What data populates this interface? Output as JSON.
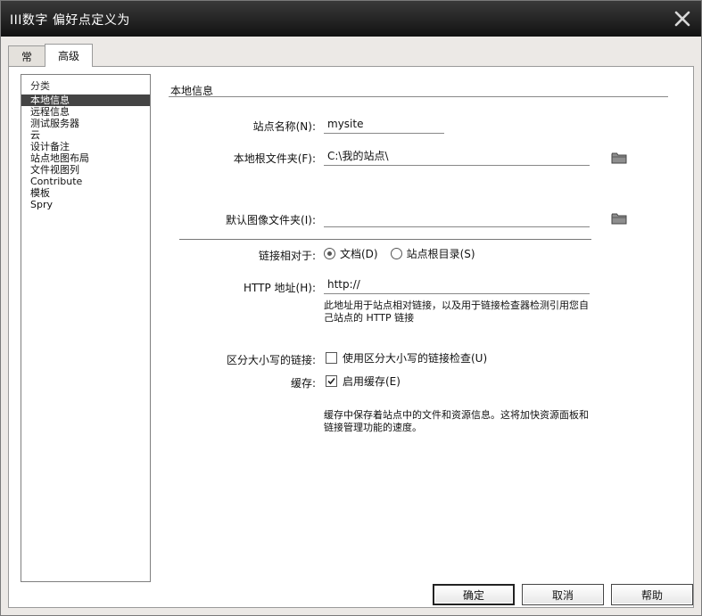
{
  "window": {
    "title": "III数字 偏好点定义为"
  },
  "tabs": [
    {
      "label": "常"
    },
    {
      "label": "高级"
    }
  ],
  "sidebar": {
    "heading": "分类",
    "items": [
      {
        "label": "本地信息"
      },
      {
        "label": "远程信息"
      },
      {
        "label": "测试服务器"
      },
      {
        "label": "云"
      },
      {
        "label": "设计备注"
      },
      {
        "label": "站点地图布局"
      },
      {
        "label": "文件视图列"
      },
      {
        "label": "Contribute"
      },
      {
        "label": "模板"
      },
      {
        "label": "Spry"
      }
    ],
    "selected_index": 0
  },
  "section": {
    "title": "本地信息"
  },
  "form": {
    "site_name_label": "站点名称(N):",
    "site_name_value": "mysite",
    "local_root_label": "本地根文件夹(F):",
    "local_root_value": "C:\\我的站点\\",
    "default_images_label": "默认图像文件夹(I):",
    "default_images_value": "",
    "links_relative_label": "链接相对于:",
    "links_relative_options": [
      {
        "label": "文档(D)",
        "checked": true
      },
      {
        "label": "站点根目录(S)",
        "checked": false
      }
    ],
    "http_address_label": "HTTP 地址(H):",
    "http_address_value": "http://",
    "http_description": "此地址用于站点相对链接，以及用于链接检查器检测引用您自己站点的 HTTP 链接",
    "case_sensitive_label": "区分大小写的链接:",
    "case_sensitive_option": "使用区分大小写的链接检查(U)",
    "case_sensitive_checked": false,
    "cache_label": "缓存:",
    "cache_option": "启用缓存(E)",
    "cache_checked": true,
    "cache_description": "缓存中保存着站点中的文件和资源信息。这将加快资源面板和链接管理功能的速度。"
  },
  "buttons": {
    "ok": "确定",
    "cancel": "取消",
    "help": "帮助"
  },
  "icons": {
    "close": "close-icon",
    "folder": "folder-icon"
  },
  "colors": {
    "titlebar": "#1f1f1f",
    "selection": "#444444"
  }
}
